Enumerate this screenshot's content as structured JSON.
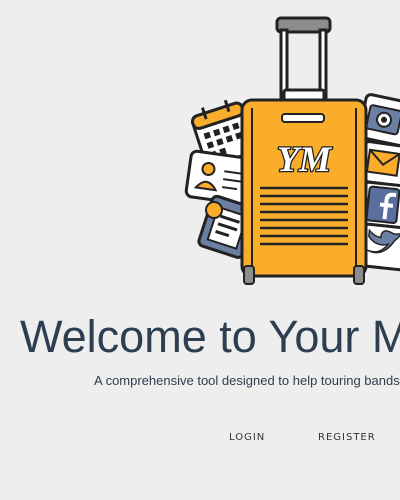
{
  "hero": {
    "logo_text": "YM",
    "illustration": "luggage-suitcase-illustration",
    "icons": [
      "calendar-icon",
      "id-card-icon",
      "document-icon",
      "camera-icon",
      "mail-icon",
      "facebook-icon",
      "twitter-icon"
    ]
  },
  "title": "Welcome to Your M",
  "subtitle": "A comprehensive tool designed to help touring bands",
  "nav": {
    "login": "LOGIN",
    "register": "REGISTER"
  },
  "colors": {
    "background": "#eeeeee",
    "suitcase": "#f9ad2a",
    "title": "#2c3e50",
    "outline": "#222222"
  }
}
